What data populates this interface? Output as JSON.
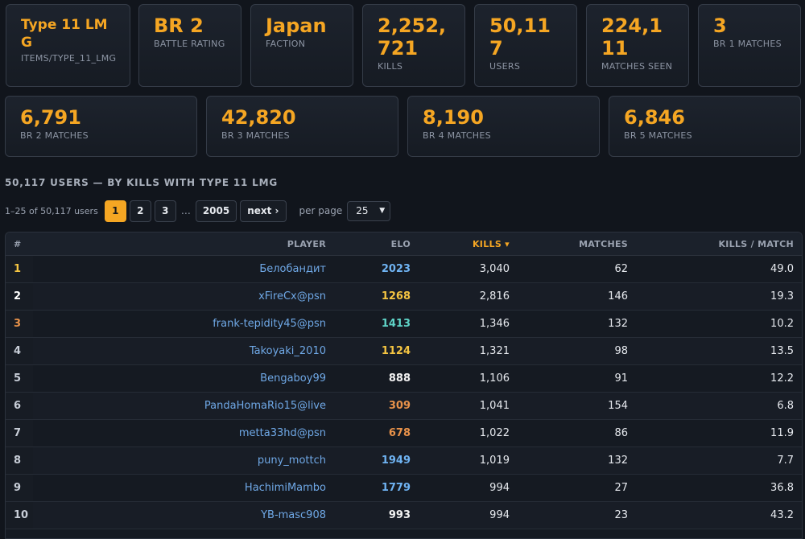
{
  "stats_top": [
    {
      "value": "Type 11 LMG",
      "label": "ITEMS/TYPE_11_LMG"
    },
    {
      "value": "BR 2",
      "label": "BATTLE RATING"
    },
    {
      "value": "Japan",
      "label": "FACTION"
    },
    {
      "value": "2,252,721",
      "label": "KILLS"
    },
    {
      "value": "50,117",
      "label": "USERS"
    },
    {
      "value": "224,111",
      "label": "MATCHES SEEN"
    },
    {
      "value": "3",
      "label": "BR 1 MATCHES"
    }
  ],
  "stats_bottom": [
    {
      "value": "6,791",
      "label": "BR 2 MATCHES"
    },
    {
      "value": "42,820",
      "label": "BR 3 MATCHES"
    },
    {
      "value": "8,190",
      "label": "BR 4 MATCHES"
    },
    {
      "value": "6,846",
      "label": "BR 5 MATCHES"
    }
  ],
  "section_title": "50,117 USERS — BY KILLS WITH TYPE 11 LMG",
  "pagination": {
    "range": "1–25 of 50,117 users",
    "pages": [
      "1",
      "2",
      "3"
    ],
    "ellipsis": "…",
    "last": "2005",
    "next": "next ›",
    "per_page_label": "per page",
    "per_page_value": "25"
  },
  "table": {
    "headers": {
      "rank": "#",
      "player": "PLAYER",
      "elo": "ELO",
      "kills": "KILLS ▾",
      "matches": "MATCHES",
      "kpm": "KILLS / MATCH"
    },
    "colors": {
      "gold": "#f5c542",
      "silver": "#ffffff",
      "bronze": "#e8924a",
      "elo_blue": "#6fb3f2",
      "elo_yellow": "#f5c542",
      "elo_teal": "#5fd4c8",
      "elo_white": "#f2f2f2",
      "elo_orange": "#e8924a"
    },
    "rows": [
      {
        "rank": "1",
        "player": "Белобандит",
        "elo": "2023",
        "elo_color": "#6fb3f2",
        "kills": "3,040",
        "matches": "62",
        "kpm": "49.0"
      },
      {
        "rank": "2",
        "player": "xFireCx@psn",
        "elo": "1268",
        "elo_color": "#f5c542",
        "kills": "2,816",
        "matches": "146",
        "kpm": "19.3"
      },
      {
        "rank": "3",
        "player": "frank-tepidity45@psn",
        "elo": "1413",
        "elo_color": "#5fd4c8",
        "kills": "1,346",
        "matches": "132",
        "kpm": "10.2"
      },
      {
        "rank": "4",
        "player": "Takoyaki_2010",
        "elo": "1124",
        "elo_color": "#f5c542",
        "kills": "1,321",
        "matches": "98",
        "kpm": "13.5"
      },
      {
        "rank": "5",
        "player": "Bengaboy99",
        "elo": "888",
        "elo_color": "#f2f2f2",
        "kills": "1,106",
        "matches": "91",
        "kpm": "12.2"
      },
      {
        "rank": "6",
        "player": "PandaHomaRio15@live",
        "elo": "309",
        "elo_color": "#e8924a",
        "kills": "1,041",
        "matches": "154",
        "kpm": "6.8"
      },
      {
        "rank": "7",
        "player": "metta33hd@psn",
        "elo": "678",
        "elo_color": "#e8924a",
        "kills": "1,022",
        "matches": "86",
        "kpm": "11.9"
      },
      {
        "rank": "8",
        "player": "puny_mottch",
        "elo": "1949",
        "elo_color": "#6fb3f2",
        "kills": "1,019",
        "matches": "132",
        "kpm": "7.7"
      },
      {
        "rank": "9",
        "player": "HachimiMambo",
        "elo": "1779",
        "elo_color": "#6fb3f2",
        "kills": "994",
        "matches": "27",
        "kpm": "36.8"
      },
      {
        "rank": "10",
        "player": "YB-masc908",
        "elo": "993",
        "elo_color": "#f2f2f2",
        "kills": "994",
        "matches": "23",
        "kpm": "43.2"
      }
    ]
  }
}
